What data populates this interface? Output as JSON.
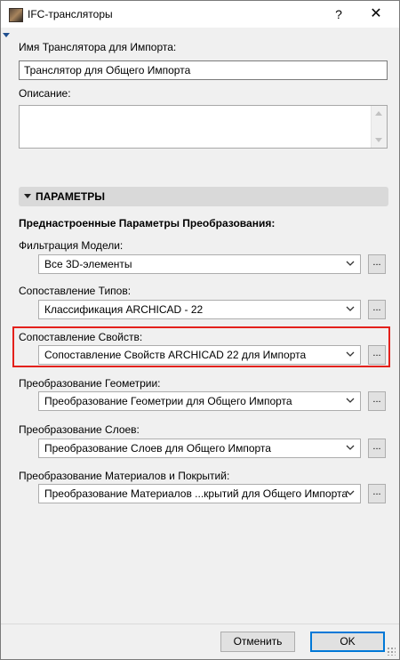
{
  "window": {
    "title": "IFC-трансляторы",
    "help_label": "?",
    "close_label": "✕"
  },
  "import_name": {
    "label": "Имя Транслятора для Импорта:",
    "value": "Транслятор для Общего Импорта"
  },
  "description": {
    "label": "Описание:",
    "value": ""
  },
  "parameters": {
    "section_title": "ПАРАМЕТРЫ",
    "preset_heading": "Преднастроенные Параметры Преобразования:",
    "rows": [
      {
        "label": "Фильтрация Модели:",
        "value": "Все 3D-элементы",
        "button": "..."
      },
      {
        "label": "Сопоставление Типов:",
        "value": "Классификация ARCHICAD - 22",
        "button": "..."
      },
      {
        "label": "Сопоставление Свойств:",
        "value": "Сопоставление Свойств ARCHICAD 22 для Импорта",
        "button": "..."
      },
      {
        "label": "Преобразование Геометрии:",
        "value": "Преобразование Геометрии для Общего Импорта",
        "button": "..."
      },
      {
        "label": "Преобразование Слоев:",
        "value": "Преобразование Слоев для Общего Импорта",
        "button": "..."
      },
      {
        "label": "Преобразование Материалов и Покрытий:",
        "value": "Преобразование Материалов ...крытий для Общего Импорта",
        "button": "..."
      }
    ]
  },
  "footer": {
    "cancel_label": "Отменить",
    "ok_label": "OK"
  },
  "colors": {
    "highlight": "#e3211c",
    "default_button_border": "#0078d7"
  }
}
